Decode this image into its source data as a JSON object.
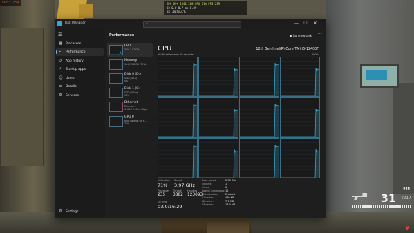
{
  "hud": {
    "fps_text": "FPS: 239",
    "perf_line1": "GPU 69% 2841 208 CPU 71% FPS 239",
    "perf_line2": "D3 0.0 0.7 ms 0.89",
    "perf_line3": "DX <DEFAULT>",
    "ammo": "31",
    "reserve": "/217"
  },
  "window": {
    "title": "Task Manager",
    "minimize": "—",
    "maximize": "☐",
    "close": "✕"
  },
  "sidebar": {
    "items": [
      {
        "label": "Processes",
        "icon": "grid-icon"
      },
      {
        "label": "Performance",
        "icon": "pulse-icon"
      },
      {
        "label": "App history",
        "icon": "history-icon"
      },
      {
        "label": "Startup apps",
        "icon": "startup-icon"
      },
      {
        "label": "Users",
        "icon": "users-icon"
      },
      {
        "label": "Details",
        "icon": "list-icon"
      },
      {
        "label": "Services",
        "icon": "services-icon"
      }
    ],
    "settings_label": "Settings"
  },
  "header": {
    "section_title": "Performance",
    "run_task_label": "Run new task",
    "more_label": "···"
  },
  "devices": [
    {
      "name": "CPU",
      "sub": "71% 3.97 GHz"
    },
    {
      "name": "Memory",
      "sub": "11.8/15.8 GB (75%)"
    },
    {
      "name": "Disk 0 (D:)",
      "sub": "SSD (SATA)\n0%"
    },
    {
      "name": "Disk 1 (C:)",
      "sub": "SSD (NVMe)\n18%"
    },
    {
      "name": "Ethernet",
      "sub": "Ethernet 2\nS: 80.0 R: 36.0 Kbps"
    },
    {
      "name": "GPU 0",
      "sub": "AMD Radeon RX 6...\n71%"
    }
  ],
  "cpu": {
    "title": "CPU",
    "model": "12th Gen Intel(R) Core(TM) i5-12400F",
    "util_label": "% Utilization over 60 seconds",
    "pct_label": "100%",
    "graph_color": "#3aa3c7",
    "utilization_label": "Utilization",
    "utilization": "71%",
    "speed_label": "Speed",
    "speed": "3.97 GHz",
    "processes_label": "Processes",
    "processes": "235",
    "threads_label": "Threads",
    "threads": "3882",
    "handles_label": "Handles",
    "handles": "123093",
    "uptime_label": "Up time",
    "uptime": "0:00:16:29",
    "specs": [
      {
        "k": "Base speed:",
        "v": "2.50 GHz"
      },
      {
        "k": "Sockets:",
        "v": "1"
      },
      {
        "k": "Cores:",
        "v": "6"
      },
      {
        "k": "Logical processors:",
        "v": "12"
      },
      {
        "k": "Virtualization:",
        "v": "Enabled"
      },
      {
        "k": "L1 cache:",
        "v": "480 KB"
      },
      {
        "k": "L2 cache:",
        "v": "7.5 MB"
      },
      {
        "k": "L3 cache:",
        "v": "18.0 MB"
      }
    ]
  }
}
